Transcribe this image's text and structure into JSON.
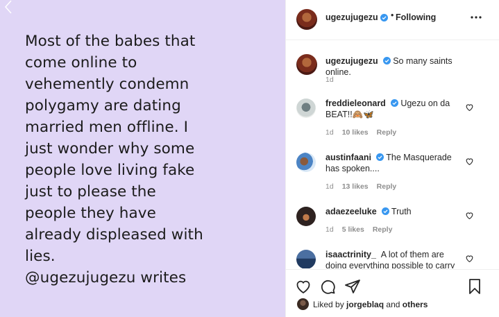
{
  "post": {
    "quote": "Most of the babes that\ncome online to\nvehemently condemn\npolygamy are dating\nmarried men offline. I\njust wonder why some\npeople love living fake\njust to please the\npeople they have\nalready displeased with\nlies.\n@ugezujugezu writes",
    "background_color": "#e0d6f6"
  },
  "header": {
    "username": "ugezujugezu",
    "separator": "•",
    "follow_status": "Following"
  },
  "comments": [
    {
      "username": "ugezujugezu",
      "verified": true,
      "text": "So many saints online.",
      "time": "1d",
      "likes": "",
      "reply": ""
    },
    {
      "username": "freddieleonard",
      "verified": true,
      "text": "Ugezu on da BEAT!!🙈🦋",
      "time": "1d",
      "likes": "10 likes",
      "reply": "Reply"
    },
    {
      "username": "austinfaani",
      "verified": true,
      "text": "The Masquerade has spoken....",
      "time": "1d",
      "likes": "13 likes",
      "reply": "Reply"
    },
    {
      "username": "adaezeeluke",
      "verified": true,
      "text": "Truth",
      "time": "1d",
      "likes": "5 likes",
      "reply": "Reply"
    },
    {
      "username": "isaactrinity_",
      "verified": false,
      "text": "A lot of them are doing everything possible to carry",
      "time": "",
      "likes": "",
      "reply": ""
    }
  ],
  "footer": {
    "liked_prefix": "Liked by",
    "liked_user": "jorgeblaq",
    "liked_and": "and",
    "liked_others": "others"
  },
  "colors": {
    "verified": "#3897f0",
    "muted": "#8e8e8e",
    "text": "#262626"
  }
}
